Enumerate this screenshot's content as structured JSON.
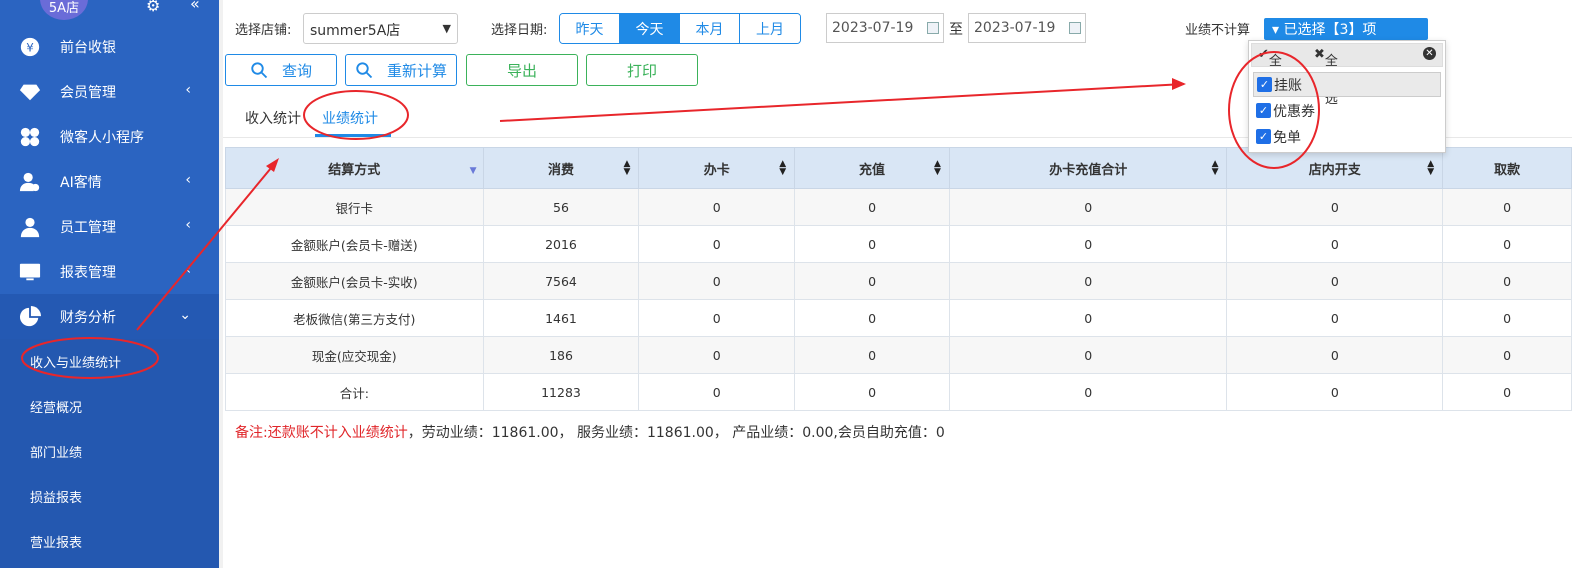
{
  "sidebar": {
    "store_badge": "5A店",
    "items": [
      {
        "label": "前台收银",
        "icon": "yen-icon",
        "arrow": ""
      },
      {
        "label": "会员管理",
        "icon": "diamond-icon",
        "arrow": "‹"
      },
      {
        "label": "微客人小程序",
        "icon": "clover-icon",
        "arrow": ""
      },
      {
        "label": "AI客情",
        "icon": "person-icon",
        "arrow": "‹"
      },
      {
        "label": "员工管理",
        "icon": "user-icon",
        "arrow": "‹"
      },
      {
        "label": "报表管理",
        "icon": "monitor-icon",
        "arrow": "‹"
      },
      {
        "label": "财务分析",
        "icon": "pie-icon",
        "arrow": "⌄"
      }
    ],
    "sub_items": [
      "收入与业绩统计",
      "经营概况",
      "部门业绩",
      "损益报表",
      "营业报表"
    ]
  },
  "filters": {
    "store_label": "选择店铺:",
    "store_value": "summer5A店",
    "date_label": "选择日期:",
    "date_buttons": [
      "昨天",
      "今天",
      "本月",
      "上月"
    ],
    "active_date": "今天",
    "date_from": "2023-07-19",
    "to_label": "至",
    "date_to": "2023-07-19",
    "perf_exclude_label": "业绩不计算",
    "perf_exclude_value": "▾ 已选择【3】项"
  },
  "actions": {
    "query": "查询",
    "recalc": "重新计算",
    "export": "导出",
    "print": "打印"
  },
  "tabs": [
    "收入统计",
    "业绩统计"
  ],
  "active_tab": "业绩统计",
  "dropdown": {
    "select_all": "全选",
    "select_none": "全不选",
    "options": [
      "挂账",
      "优惠券",
      "免单"
    ]
  },
  "table": {
    "headers": [
      "结算方式",
      "消费",
      "办卡",
      "充值",
      "办卡充值合计",
      "店内开支",
      "取款"
    ],
    "rows": [
      [
        "银行卡",
        "56",
        "0",
        "0",
        "0",
        "0",
        "0"
      ],
      [
        "金额账户(会员卡-赠送)",
        "2016",
        "0",
        "0",
        "0",
        "0",
        "0"
      ],
      [
        "金额账户(会员卡-实收)",
        "7564",
        "0",
        "0",
        "0",
        "0",
        "0"
      ],
      [
        "老板微信(第三方支付)",
        "1461",
        "0",
        "0",
        "0",
        "0",
        "0"
      ],
      [
        "现金(应交现金)",
        "186",
        "0",
        "0",
        "0",
        "0",
        "0"
      ],
      [
        "合计:",
        "11283",
        "0",
        "0",
        "0",
        "0",
        "0"
      ]
    ]
  },
  "note": {
    "red": "备注:还款账不计入业绩统计",
    "rest": "，劳动业绩：11861.00， 服务业绩：11861.00， 产品业绩：0.00,会员自助充值：0"
  }
}
